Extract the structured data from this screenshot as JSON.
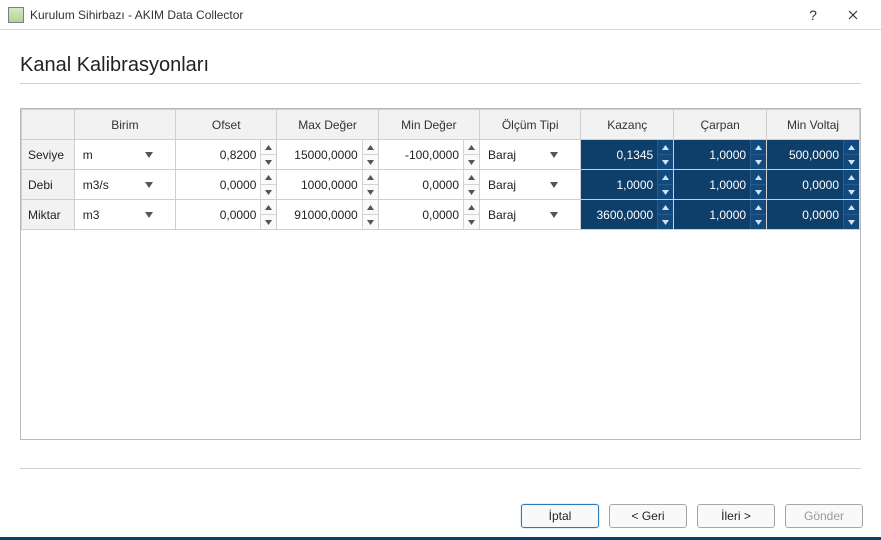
{
  "window": {
    "title": "Kurulum Sihirbazı - AKIM Data Collector"
  },
  "page": {
    "heading": "Kanal Kalibrasyonları"
  },
  "headers": {
    "birim": "Birim",
    "ofset": "Ofset",
    "max_deger": "Max Değer",
    "min_deger": "Min Değer",
    "olcum_tipi": "Ölçüm Tipi",
    "kazanc": "Kazanç",
    "carpan": "Çarpan",
    "min_voltaj": "Min Voltaj"
  },
  "rows": [
    {
      "name": "Seviye",
      "birim": "m",
      "ofset": "0,8200",
      "max_deger": "15000,0000",
      "min_deger": "-100,0000",
      "olcum_tipi": "Baraj",
      "kazanc": "0,1345",
      "carpan": "1,0000",
      "min_voltaj": "500,0000"
    },
    {
      "name": "Debi",
      "birim": "m3/s",
      "ofset": "0,0000",
      "max_deger": "1000,0000",
      "min_deger": "0,0000",
      "olcum_tipi": "Baraj",
      "kazanc": "1,0000",
      "carpan": "1,0000",
      "min_voltaj": "0,0000"
    },
    {
      "name": "Miktar",
      "birim": "m3",
      "ofset": "0,0000",
      "max_deger": "91000,0000",
      "min_deger": "0,0000",
      "olcum_tipi": "Baraj",
      "kazanc": "3600,0000",
      "carpan": "1,0000",
      "min_voltaj": "0,0000"
    }
  ],
  "buttons": {
    "iptal": "İptal",
    "geri": "< Geri",
    "ileri": "İleri >",
    "gonder": "Gönder"
  }
}
